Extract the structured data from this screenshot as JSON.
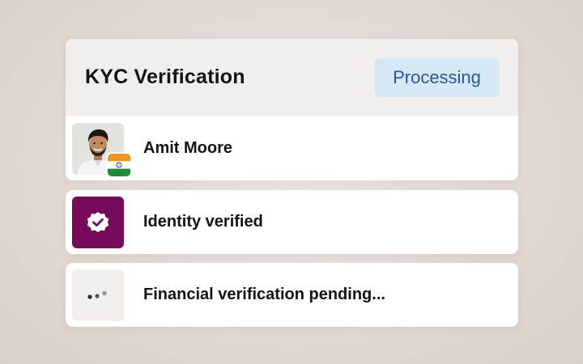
{
  "kyc": {
    "title": "KYC Verification",
    "status_badge": "Processing",
    "status_color": "#2a58a0",
    "status_bg": "#d6e7f6"
  },
  "user": {
    "name": "Amit Moore",
    "avatar_icon": "user-photo",
    "flag_icon": "india-flag-icon"
  },
  "steps": [
    {
      "label": "Identity verified",
      "icon": "verified-badge-icon",
      "icon_bg": "#780a5c"
    },
    {
      "label": "Financial verification pending...",
      "icon": "loading-dots-icon",
      "icon_bg": "#f1eeeb"
    }
  ]
}
